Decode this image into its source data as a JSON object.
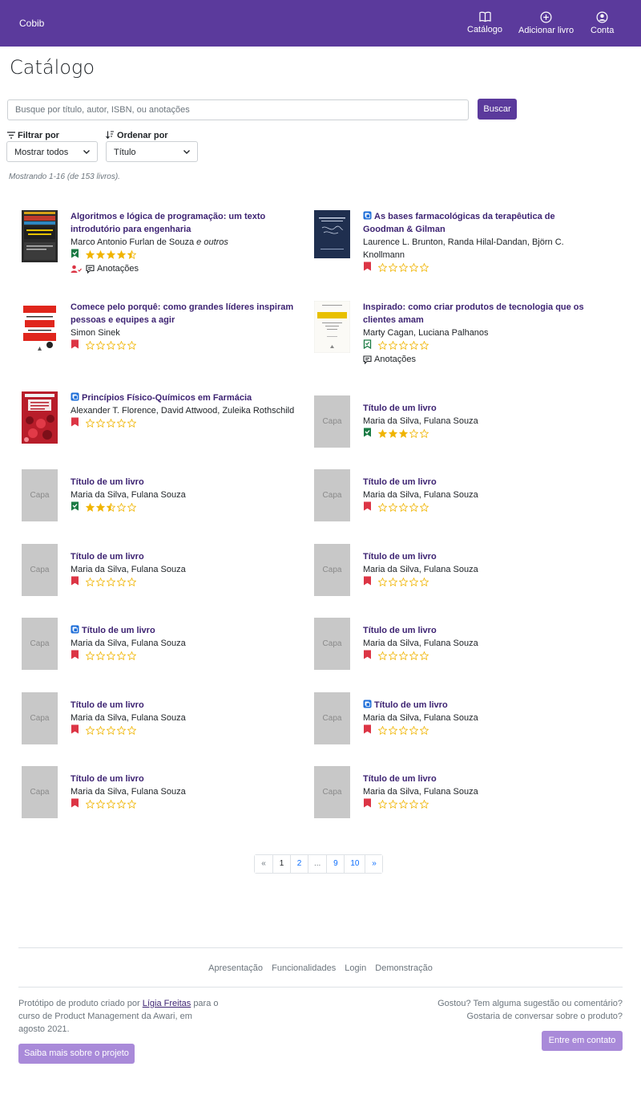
{
  "navbar": {
    "brand": "Cobib",
    "items": [
      {
        "label": "Catálogo",
        "icon": "book-open-icon"
      },
      {
        "label": "Adicionar livro",
        "icon": "plus-circle-icon"
      },
      {
        "label": "Conta",
        "icon": "person-circle-icon"
      }
    ],
    "color": "#5b3a9c"
  },
  "page": {
    "title": "Catálogo"
  },
  "search": {
    "placeholder": "Busque por título, autor, ISBN, ou anotações",
    "value": "",
    "button": "Buscar"
  },
  "filter": {
    "label": "Filtrar por",
    "selected": "Mostrar todos"
  },
  "sort": {
    "label": "Ordenar por",
    "selected": "Título"
  },
  "results_info": "Mostrando 1-16 (de 153 livros).",
  "books": [
    {
      "title": "Algoritmos e lógica de programação: um texto introdutório para engenharia",
      "authors": "Marco Antonio Furlan de Souza",
      "authors_suffix": "e outros",
      "ebook": false,
      "status": "read",
      "rating": 4.5,
      "lent": true,
      "notes": "Anotações",
      "cover": "algoritmos"
    },
    {
      "title": "As bases farmacológicas da terapêutica de Goodman & Gilman",
      "authors": "Laurence L. Brunton, Randa Hilal-Dandan, Björn C. Knollmann",
      "ebook": true,
      "status": "unread",
      "rating": 0,
      "cover": "goodman"
    },
    {
      "title": "Comece pelo porquê: como grandes líderes inspiram pessoas e equipes a agir",
      "authors": "Simon Sinek",
      "ebook": false,
      "status": "unread",
      "rating": 0,
      "cover": "comece"
    },
    {
      "title": "Inspirado: como criar produtos de tecnologia que os clientes amam",
      "authors": "Marty Cagan, Luciana Palhanos",
      "ebook": false,
      "status": "reading",
      "rating": 0,
      "notes": "Anotações",
      "cover": "inspirado"
    },
    {
      "title": "Princípios Físico-Químicos em Farmácia",
      "authors": "Alexander T. Florence, David Attwood, Zuleika Rothschild",
      "ebook": true,
      "status": "unread",
      "rating": 0,
      "cover": "principios"
    },
    {
      "title": "Título de um livro",
      "authors": "Maria da Silva, Fulana Souza",
      "ebook": false,
      "status": "read",
      "rating": 3,
      "cover": "placeholder"
    },
    {
      "title": "Título de um livro",
      "authors": "Maria da Silva, Fulana Souza",
      "ebook": false,
      "status": "read",
      "rating": 2.5,
      "cover": "placeholder"
    },
    {
      "title": "Título de um livro",
      "authors": "Maria da Silva, Fulana Souza",
      "ebook": false,
      "status": "unread",
      "rating": 0,
      "cover": "placeholder"
    },
    {
      "title": "Título de um livro",
      "authors": "Maria da Silva, Fulana Souza",
      "ebook": false,
      "status": "unread",
      "rating": 0,
      "cover": "placeholder"
    },
    {
      "title": "Título de um livro",
      "authors": "Maria da Silva, Fulana Souza",
      "ebook": false,
      "status": "unread",
      "rating": 0,
      "cover": "placeholder"
    },
    {
      "title": "Título de um livro",
      "authors": "Maria da Silva, Fulana Souza",
      "ebook": true,
      "status": "unread",
      "rating": 0,
      "cover": "placeholder"
    },
    {
      "title": "Título de um livro",
      "authors": "Maria da Silva, Fulana Souza",
      "ebook": false,
      "status": "unread",
      "rating": 0,
      "cover": "placeholder"
    },
    {
      "title": "Título de um livro",
      "authors": "Maria da Silva, Fulana Souza",
      "ebook": false,
      "status": "unread",
      "rating": 0,
      "cover": "placeholder"
    },
    {
      "title": "Título de um livro",
      "authors": "Maria da Silva, Fulana Souza",
      "ebook": true,
      "status": "unread",
      "rating": 0,
      "cover": "placeholder"
    },
    {
      "title": "Título de um livro",
      "authors": "Maria da Silva, Fulana Souza",
      "ebook": false,
      "status": "unread",
      "rating": 0,
      "cover": "placeholder"
    },
    {
      "title": "Título de um livro",
      "authors": "Maria da Silva, Fulana Souza",
      "ebook": false,
      "status": "unread",
      "rating": 0,
      "cover": "placeholder"
    }
  ],
  "placeholder_cover_label": "Capa",
  "pagination": [
    "«",
    "1",
    "2",
    "...",
    "9",
    "10",
    "»"
  ],
  "footer": {
    "links": [
      "Apresentação",
      "Funcionalidades",
      "Login",
      "Demonstração"
    ],
    "credits_prefix": "Protótipo de produto criado por",
    "credits_author": "Lígia Freitas",
    "credits_suffix": "para o curso de Product Management da Awari, em agosto 2021.",
    "about_button": "Saiba mais sobre o projeto",
    "feedback_line1": "Gostou? Tem alguma sugestão ou comentário?",
    "feedback_line2": "Gostaria de conversar sobre o produto?",
    "contact_button": "Entre em contato"
  },
  "colors": {
    "primary": "#5b3a9c",
    "title": "#3d2372",
    "star": "#f0b400",
    "read": "#1a7a43",
    "unread": "#dc3545",
    "placeholder": "#c8c8c8"
  }
}
